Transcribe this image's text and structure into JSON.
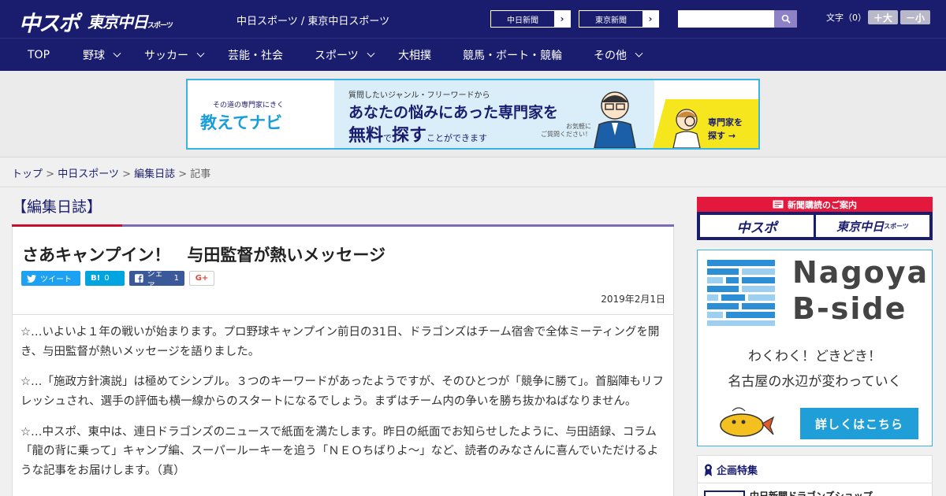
{
  "header": {
    "logo_chuspo": "中スポ",
    "logo_tokyo": "東京中日",
    "logo_tokyo_small": "スポーツ",
    "site_title": "中日スポーツ / 東京中日スポーツ",
    "paper_buttons": [
      "中日新聞",
      "東京新聞"
    ],
    "search_placeholder": "",
    "font_label": "文字（0）",
    "font_bigger": "＋大",
    "font_smaller": "－小"
  },
  "nav": {
    "items": [
      {
        "label": "TOP",
        "dropdown": false
      },
      {
        "label": "野球",
        "dropdown": true
      },
      {
        "label": "サッカー",
        "dropdown": true
      },
      {
        "label": "芸能・社会",
        "dropdown": false
      },
      {
        "label": "スポーツ",
        "dropdown": true
      },
      {
        "label": "大相撲",
        "dropdown": false
      },
      {
        "label": "競馬・ボート・競輪",
        "dropdown": false
      },
      {
        "label": "その他",
        "dropdown": true
      }
    ]
  },
  "ad": {
    "brand_sub": "その道の専門家にきく",
    "brand_main": "教えてナビ",
    "line1": "質問したいジャンル・フリーワードから",
    "line2": "あなたの悩みにあった専門家を",
    "line3a": "無料",
    "line3b": "で",
    "line3c": "探す",
    "line3d": "ことができます",
    "note1": "お気軽に",
    "note2": "ご質問ください！",
    "cta1": "専門家を",
    "cta2": "探す →"
  },
  "breadcrumb": {
    "items": [
      "トップ",
      "中日スポーツ",
      "編集日誌"
    ],
    "current": "記事",
    "sep": " > "
  },
  "article": {
    "section": "【編集日誌】",
    "title": "さあキャンプイン！　与田監督が熱いメッセージ",
    "share": {
      "tweet": "ツイート",
      "hatena_label": "B!",
      "hatena_count": "0",
      "fb_label": "シェア",
      "fb_count": "1",
      "gplus": "G+"
    },
    "date": "2019年2月1日",
    "paragraphs": [
      "☆…いよいよ１年の戦いが始まります。プロ野球キャンプイン前日の31日、ドラゴンズはチーム宿舎で全体ミーティングを開き、与田監督が熱いメッセージを語りました。",
      "☆…「施政方針演説」は極めてシンプル。３つのキーワードがあったようですが、そのひとつが「競争に勝て」。首脳陣もリフレッシュされ、選手の評価も横一線からのスタートになるでしょう。まずはチーム内の争いを勝ち抜かねばなりません。",
      "☆…中スポ、東中は、連日ドラゴンズのニュースで紙面を満たします。昨日の紙面でお知らせしたように、与田語録、コラム「龍の背に乗って」キャンプ編、スーパールーキーを追う「ＮＥＯちばりよ～」など、読者のみなさんに喜んでいただけるような記事をお届けします。（真）"
    ]
  },
  "sidebar": {
    "subscribe_head": "新聞購読のご案内",
    "subscribe_buttons": [
      "中スポ",
      "東京中日"
    ],
    "subscribe_small": "スポーツ",
    "nagoya_title1": "Nagoya",
    "nagoya_title2": "B-side",
    "nagoya_text1": "わくわく！どきどき！",
    "nagoya_text2": "名古屋の水辺が変わっていく",
    "nagoya_button": "詳しくはこちら",
    "kikaku_head": "企画特集",
    "kikaku_item": "中日新聞ドラゴンズショップ"
  },
  "colors": {
    "brand_navy": "#1a1d6e",
    "accent_red": "#c8102e",
    "accent_purple": "#7b6bb5",
    "link_blue": "#1f9ed8"
  }
}
